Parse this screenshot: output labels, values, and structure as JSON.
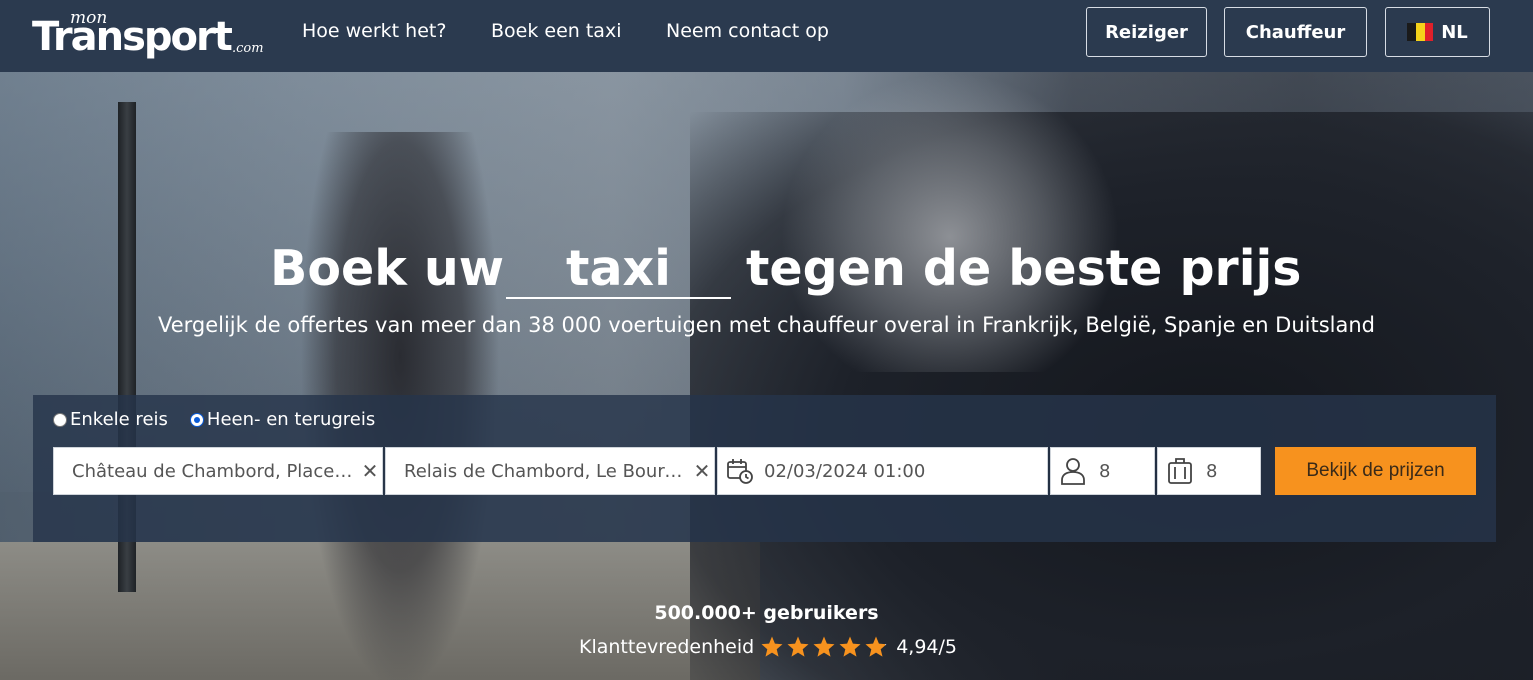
{
  "brand": {
    "mon": "mon",
    "transport": "Transport",
    "com": ".com"
  },
  "nav": {
    "links": [
      "Hoe werkt het?",
      "Boek een taxi",
      "Neem contact op"
    ],
    "traveler_button": "Reiziger",
    "driver_button": "Chauffeur",
    "language": "NL",
    "flag_colors": [
      "#1a1a1a",
      "#f5d21a",
      "#e0202a"
    ]
  },
  "hero": {
    "headline_before": "Boek uw",
    "headline_word": "taxi",
    "headline_after": "tegen de beste prijs",
    "subtitle": "Vergelijk de offertes van meer dan 38 000 voertuigen met chauffeur overal in Frankrijk, België, Spanje en Duitsland"
  },
  "search": {
    "trip_options": [
      {
        "label": "Enkele reis",
        "selected": false
      },
      {
        "label": "Heen- en terugreis",
        "selected": true
      }
    ],
    "from": "Château de Chambord, Place Saint-Louis, Chambord",
    "to": "Relais de Chambord, Le Bourg, Chambord",
    "datetime": "02/03/2024 01:00",
    "passengers": "8",
    "luggage": "8",
    "submit_label": "Bekijk de prijzen",
    "accent_color": "#f7921e"
  },
  "stats": {
    "users": "500.000+ gebruikers",
    "satisfaction_label": "Klanttevredenheid",
    "rating_value": 4.94,
    "rating_text": "4,94/5",
    "star_color": "#f7921e"
  }
}
